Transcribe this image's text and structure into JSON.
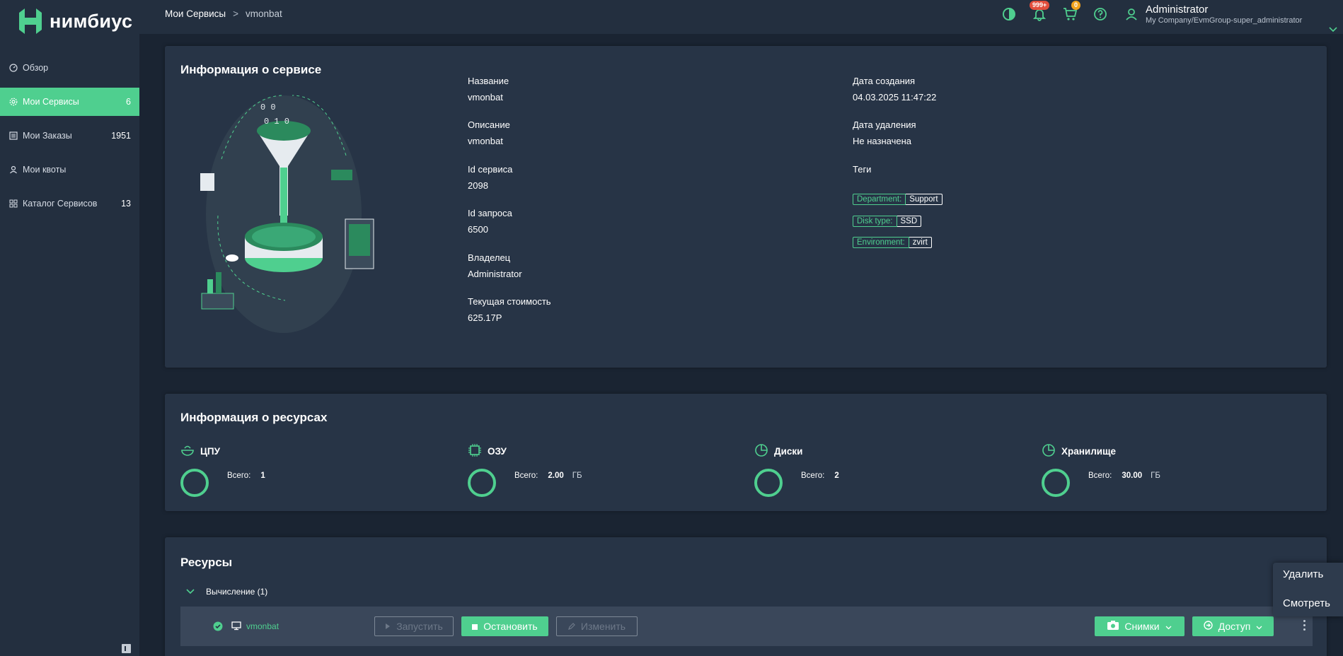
{
  "brand": {
    "name": "нимбиус",
    "accent": "#4fcf8f"
  },
  "sidebar": {
    "items": [
      {
        "label": "Обзор",
        "count": "",
        "icon": "gauge-icon"
      },
      {
        "label": "Мои Сервисы",
        "count": "6",
        "icon": "gear-icon",
        "active": true
      },
      {
        "label": "Мои Заказы",
        "count": "1951",
        "icon": "list-icon"
      },
      {
        "label": "Мои квоты",
        "count": "",
        "icon": "user-icon"
      },
      {
        "label": "Каталог Сервисов",
        "count": "13",
        "icon": "grid-icon"
      }
    ]
  },
  "header": {
    "breadcrumb": [
      "Мои Сервисы",
      "vmonbat"
    ],
    "breadcrumb_sep": ">",
    "notifications_badge": "999+",
    "cart_badge": "0",
    "user_name": "Administrator",
    "user_org": "My Company/EvmGroup-super_administrator"
  },
  "service_info": {
    "title": "Информация о сервисе",
    "fields_left": [
      {
        "label": "Название",
        "value": "vmonbat"
      },
      {
        "label": "Описание",
        "value": "vmonbat"
      },
      {
        "label": "Id сервиса",
        "value": "2098"
      },
      {
        "label": "Id запроса",
        "value": "6500"
      },
      {
        "label": "Владелец",
        "value": "Administrator"
      },
      {
        "label": "Текущая стоимость",
        "value": "625.17Р"
      }
    ],
    "fields_right": [
      {
        "label": "Дата создания",
        "value": "04.03.2025 11:47:22"
      },
      {
        "label": "Дата удаления",
        "value": "Не назначена"
      }
    ],
    "tags_label": "Теги",
    "tags": [
      {
        "key": "Department:",
        "value": "Support"
      },
      {
        "key": "Disk type:",
        "value": "SSD"
      },
      {
        "key": "Environment:",
        "value": "zvirt"
      }
    ]
  },
  "resource_info": {
    "title": "Информация о ресурсах",
    "total_label": "Всего:",
    "items": [
      {
        "name": "ЦПУ",
        "total": "1",
        "unit": "",
        "icon": "cpu-bowl-icon"
      },
      {
        "name": "ОЗУ",
        "total": "2.00",
        "unit": "ГБ",
        "icon": "chip-icon"
      },
      {
        "name": "Диски",
        "total": "2",
        "unit": "",
        "icon": "pie-icon"
      },
      {
        "name": "Хранилище",
        "total": "30.00",
        "unit": "ГБ",
        "icon": "pie-icon"
      }
    ]
  },
  "resources": {
    "title": "Ресурсы",
    "group_label": "Вычисление (1)",
    "vm": {
      "name": "vmonbat",
      "start_label": "Запустить",
      "stop_label": "Остановить",
      "edit_label": "Изменить",
      "snapshots_label": "Снимки",
      "access_label": "Доступ"
    }
  },
  "context_menu": {
    "items": [
      "Удалить",
      "Смотреть"
    ]
  }
}
